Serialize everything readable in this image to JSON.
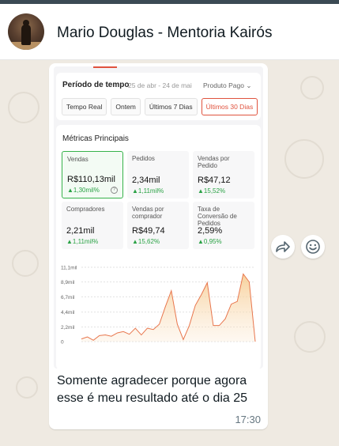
{
  "header": {
    "contact_name": "Mario Douglas - Mentoria Kairós"
  },
  "message": {
    "text": "Somente agradecer porque agora esse é meu resultado até o dia 25",
    "time": "17:30",
    "screenshot": {
      "period_label": "Período de tempo",
      "period_dates": "25 de abr - 24 de mai",
      "product_select": "Produto Pago",
      "chips": [
        "Tempo Real",
        "Ontem",
        "Últimos 7 Dias",
        "Últimos 30 Dias"
      ],
      "active_chip": "Últimos 30 Dias",
      "metrics_title": "Métricas Principais",
      "metrics": [
        {
          "label": "Vendas",
          "value": "R$110,13mil",
          "change": "▲1,30mil%",
          "selected": true,
          "help": "?"
        },
        {
          "label": "Pedidos",
          "value": "2,34mil",
          "change": "▲1,11mil%"
        },
        {
          "label": "Vendas por Pedido",
          "value": "R$47,12",
          "change": "▲15,52%"
        },
        {
          "label": "Compradores",
          "value": "2,21mil",
          "change": "▲1,11mil%"
        },
        {
          "label": "Vendas por comprador",
          "value": "R$49,74",
          "change": "▲15,62%"
        },
        {
          "label": "Taxa de Conversão de Pedidos",
          "value": "2,59%",
          "change": "▲0,95%"
        }
      ],
      "chart_data": {
        "type": "area",
        "ytick_labels": [
          "11,1mil",
          "8,9mil",
          "6,7mil",
          "4,4mil",
          "2,2mil",
          "0"
        ],
        "yticks": [
          11.1,
          8.9,
          6.7,
          4.4,
          2.2,
          0
        ],
        "ylim": [
          0,
          11.1
        ],
        "x": [
          1,
          2,
          3,
          4,
          5,
          6,
          7,
          8,
          9,
          10,
          11,
          12,
          13,
          14,
          15,
          16,
          17,
          18,
          19,
          20,
          21,
          22,
          23,
          24,
          25,
          26,
          27,
          28,
          29,
          30
        ],
        "values": [
          0.4,
          0.7,
          0.2,
          0.9,
          1.0,
          0.8,
          1.3,
          1.5,
          1.1,
          2.0,
          1.0,
          2.0,
          1.8,
          2.6,
          5.2,
          7.6,
          2.6,
          0.3,
          2.4,
          5.4,
          7.0,
          8.8,
          2.4,
          2.4,
          3.4,
          5.6,
          6.0,
          10.1,
          8.9,
          0
        ],
        "color": "#e8764d"
      }
    }
  },
  "actions": {
    "forward_icon": "forward-arrow-icon",
    "emoji_icon": "smiley-icon"
  },
  "colors": {
    "accent_red": "#e0533e",
    "positive_green": "#2aa245",
    "wallpaper": "#efeae2"
  }
}
